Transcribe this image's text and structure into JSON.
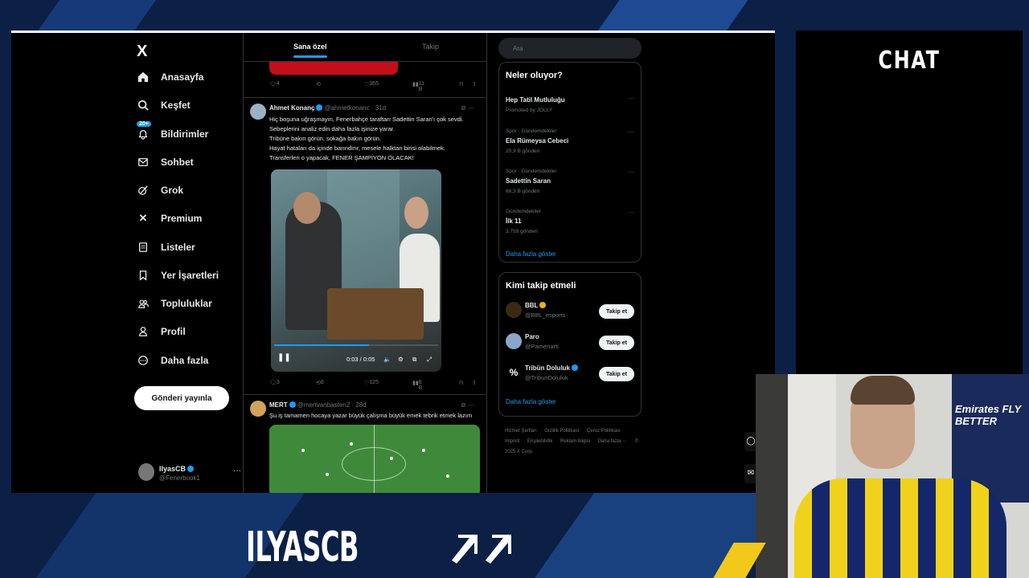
{
  "app": {
    "logo": "X"
  },
  "nav": {
    "items": [
      {
        "label": "Anasayfa",
        "icon": "home-icon"
      },
      {
        "label": "Keşfet",
        "icon": "search-icon"
      },
      {
        "label": "Bildirimler",
        "icon": "bell-icon",
        "badge": "20+"
      },
      {
        "label": "Sohbet",
        "icon": "mail-icon"
      },
      {
        "label": "Grok",
        "icon": "grok-icon"
      },
      {
        "label": "Premium",
        "icon": "x-icon"
      },
      {
        "label": "Listeler",
        "icon": "list-icon"
      },
      {
        "label": "Yer İşaretleri",
        "icon": "bookmark-icon"
      },
      {
        "label": "Topluluklar",
        "icon": "people-icon"
      },
      {
        "label": "Profil",
        "icon": "person-icon"
      },
      {
        "label": "Daha fazla",
        "icon": "more-circle-icon"
      }
    ],
    "post_button": "Gönderi yayınla",
    "account": {
      "name": "IlyasCB",
      "handle": "@Fenerbook1"
    }
  },
  "timeline": {
    "tabs": [
      {
        "label": "Sana özel",
        "active": true
      },
      {
        "label": "Takip",
        "active": false
      }
    ],
    "top_actions": {
      "replies": "4",
      "likes": "365",
      "views": "11 B"
    },
    "tweets": [
      {
        "name": "Ahmet Konanç",
        "handle": "@ahmetkonanc · 31d",
        "lines": [
          "Hiç boşuna uğraşmayın, Fenerbahçe taraftarı Sadettin Saran'ı çok sevdi.",
          "Sebeplerini analiz edin daha fazla işinize yarar.",
          "Tribüne bakın görün, sokağa bakın görün.",
          "Hayat hataları da içinde barındırır, mesele halktan birisi olabilmek.",
          "Transferleri o yapacak, FENER ŞAMPİYON OLACAK!"
        ],
        "video_time": "0:03 / 0:05",
        "video_progress": 0.58,
        "actions": {
          "replies": "3",
          "reposts": "8",
          "likes": "125",
          "views": "8 B"
        }
      },
      {
        "name": "MERT",
        "handle": "@mertvanbasten2 · 28d",
        "lines": [
          "Şu iş tamamen hocaya yazar büyük çalışma büyük emek tebrik etmek lazım"
        ]
      }
    ]
  },
  "right": {
    "search_placeholder": "Ara",
    "trends_title": "Neler oluyor?",
    "trends": [
      {
        "meta": "",
        "name": "Hep Tatil Mutluluğu",
        "sub": "Promoted by JOLLY"
      },
      {
        "meta": "Spor · Gündemdekiler",
        "name": "Ela Rümeysa Cebeci",
        "sub": "20,9 B gönderi"
      },
      {
        "meta": "Spor · Gündemdekiler",
        "name": "Sadettin Saran",
        "sub": "66,3 B gönderi"
      },
      {
        "meta": "Gündemdekiler",
        "name": "İlk 11",
        "sub": "3.759 gönderi"
      }
    ],
    "show_more": "Daha fazla göster",
    "follow_title": "Kimi takip etmeli",
    "follow": [
      {
        "name": "BBL",
        "handle": "@BBL_esports",
        "verified": "gold"
      },
      {
        "name": "Paro",
        "handle": "@Pamenarti",
        "verified": ""
      },
      {
        "name": "Tribün Doluluk",
        "handle": "@TribunDoluluk",
        "verified": "blue"
      }
    ],
    "follow_button": "Takip et",
    "footer": [
      "Hizmet Şartları",
      "Gizlilik Politikası",
      "Çerez Politikası",
      "Imprint",
      "Erişilebilirlik",
      "Reklam bilgisi",
      "Daha fazla ···",
      "© 2025 X Corp."
    ]
  },
  "stream": {
    "chat_title": "CHAT",
    "brand": "ILYASCB",
    "jersey_text": "Emirates FLY BETTER"
  },
  "colors": {
    "accent": "#1d9bf0",
    "background": "#0c1f45",
    "gold": "#e8b416"
  }
}
